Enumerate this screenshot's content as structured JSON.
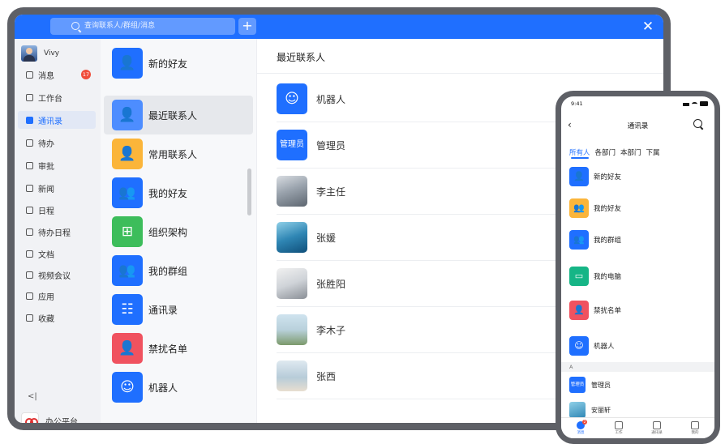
{
  "colors": {
    "primary": "#1f6fff",
    "badge_red": "#f04d3a",
    "tile_blue": "#1f6fff",
    "tile_blue_light": "#4d8dff",
    "tile_yellow": "#fbb53a",
    "tile_green": "#3dbd5b",
    "tile_red": "#f0525f",
    "tile_teal": "#16b586"
  },
  "tablet": {
    "search": {
      "placeholder": "查询联系人/群组/消息"
    },
    "user": {
      "name": "Vivy"
    },
    "nav": [
      {
        "label": "消息",
        "icon": "chat-icon",
        "badge": "17"
      },
      {
        "label": "工作台",
        "icon": "workbench-icon"
      },
      {
        "label": "通讯录",
        "icon": "contacts-icon",
        "active": true
      },
      {
        "label": "待办",
        "icon": "todo-icon"
      },
      {
        "label": "审批",
        "icon": "approval-icon"
      },
      {
        "label": "新闻",
        "icon": "news-icon"
      },
      {
        "label": "日程",
        "icon": "calendar-icon"
      },
      {
        "label": "待办日程",
        "icon": "todo-calendar-icon"
      },
      {
        "label": "文档",
        "icon": "document-icon"
      },
      {
        "label": "视频会议",
        "icon": "video-icon"
      },
      {
        "label": "应用",
        "icon": "apps-icon"
      },
      {
        "label": "收藏",
        "icon": "favorite-icon"
      }
    ],
    "platform": {
      "label": "办公平台"
    },
    "middle": [
      {
        "label": "新的好友",
        "icon": "add-friend-icon",
        "color": "#1f6fff"
      },
      {
        "label": "最近联系人",
        "icon": "person-icon",
        "color": "#4d8dff",
        "active": true
      },
      {
        "label": "常用联系人",
        "icon": "person-icon",
        "color": "#fbb53a"
      },
      {
        "label": "我的好友",
        "icon": "friends-icon",
        "color": "#1f6fff"
      },
      {
        "label": "组织架构",
        "icon": "org-chart-icon",
        "color": "#3dbd5b"
      },
      {
        "label": "我的群组",
        "icon": "group-icon",
        "color": "#1f6fff"
      },
      {
        "label": "通讯录",
        "icon": "address-book-icon",
        "color": "#1f6fff"
      },
      {
        "label": "禁扰名单",
        "icon": "block-icon",
        "color": "#f0525f"
      },
      {
        "label": "机器人",
        "icon": "robot-icon",
        "color": "#1f6fff"
      }
    ],
    "main": {
      "title": "最近联系人",
      "contacts": [
        {
          "name": "机器人",
          "kind": "robot-icon"
        },
        {
          "name": "管理员",
          "kind": "text",
          "avatar_text": "管理员"
        },
        {
          "name": "李主任",
          "kind": "photo-mountain"
        },
        {
          "name": "张媛",
          "kind": "photo-sea"
        },
        {
          "name": "张胜阳",
          "kind": "photo-desk"
        },
        {
          "name": "李木子",
          "kind": "photo-tree"
        },
        {
          "name": "张西",
          "kind": "photo-beach"
        }
      ]
    }
  },
  "phone": {
    "time": "9:41",
    "title": "通讯录",
    "tabs": [
      "所有人",
      "各部门",
      "本部门",
      "下属"
    ],
    "items": [
      {
        "label": "新的好友",
        "icon": "add-friend-icon",
        "color": "#1f6fff"
      },
      {
        "label": "我的好友",
        "icon": "friends-icon",
        "color": "#fbb53a"
      },
      {
        "label": "我的群组",
        "icon": "group-icon",
        "color": "#1f6fff"
      },
      {
        "label": "我的电脑",
        "icon": "computer-icon",
        "color": "#16b586"
      },
      {
        "label": "禁扰名单",
        "icon": "block-icon",
        "color": "#f0525f"
      },
      {
        "label": "机器人",
        "icon": "robot-icon",
        "color": "#1f6fff"
      }
    ],
    "section_letter": "A",
    "contacts": [
      {
        "name": "管理员",
        "avatar_text": "管理员"
      },
      {
        "name": "安丽轩"
      }
    ],
    "bottom_nav": [
      {
        "label": "消息",
        "badge": "2",
        "active": true
      },
      {
        "label": "工作"
      },
      {
        "label": "通讯录"
      },
      {
        "label": "我的"
      }
    ]
  }
}
